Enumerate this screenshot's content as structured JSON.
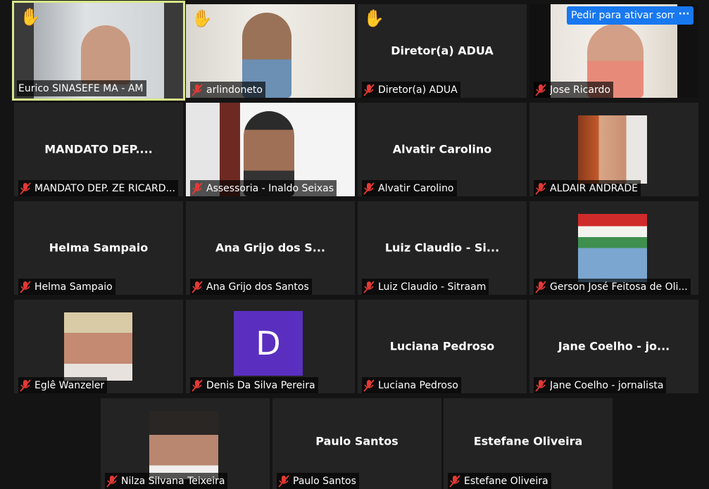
{
  "colors": {
    "background": "#141414",
    "tile": "#232323",
    "active_speaker_border": "#d8e88a",
    "muted_icon": "#e53935",
    "button_blue": "#1878f0",
    "avatar_purple": "#5a2fbf"
  },
  "controls": {
    "request_audio": "Pedir para ativar som",
    "more_options": "···"
  },
  "participants": [
    {
      "label": "Eurico SINASEFE MA - AM",
      "muted_icon": false,
      "hand_raised": true,
      "active_speaker": true
    },
    {
      "label": "arlindoneto",
      "muted_icon": "muted-mic-icon",
      "hand_raised": true
    },
    {
      "label": "Diretor(a) ADUA",
      "display": "Diretor(a) ADUA",
      "muted_icon": "muted-mic-icon",
      "hand_raised": true
    },
    {
      "label": "Jose Ricardo",
      "muted_icon": "muted-mic-icon"
    },
    {
      "label": "MANDATO DEP. ZÉ RICARD...",
      "display": "MANDATO DEP....",
      "muted_icon": "muted-mic-icon"
    },
    {
      "label": "Assessoria - Inaldo Seixas",
      "muted_icon": "muted-mic-icon"
    },
    {
      "label": "Alvatir Carolino",
      "display": "Alvatir Carolino",
      "muted_icon": "muted-mic-icon"
    },
    {
      "label": "ALDAIR ANDRADE",
      "muted_icon": "muted-mic-icon"
    },
    {
      "label": "Helma Sampaio",
      "display": "Helma Sampaio",
      "muted_icon": "muted-mic-icon"
    },
    {
      "label": "Ana Grijo dos Santos",
      "display": "Ana Grijo dos S...",
      "muted_icon": "muted-mic-icon"
    },
    {
      "label": "Luiz Claudio - Sitraam",
      "display": "Luiz Claudio - Si...",
      "muted_icon": "muted-mic-icon"
    },
    {
      "label": "Gerson José Feitosa de Oli...",
      "muted_icon": "muted-mic-icon"
    },
    {
      "label": "Eglê Wanzeler",
      "muted_icon": "muted-mic-icon"
    },
    {
      "label": "Denis Da Silva Pereira",
      "avatar_letter": "D",
      "muted_icon": "muted-mic-icon"
    },
    {
      "label": "Luciana Pedroso",
      "display": "Luciana Pedroso",
      "muted_icon": "muted-mic-icon"
    },
    {
      "label": "Jane Coelho - jornalista",
      "display": "Jane Coelho - jo...",
      "muted_icon": "muted-mic-icon"
    },
    {
      "label": "Nilza Silvana Teixeira",
      "muted_icon": "muted-mic-icon"
    },
    {
      "label": "Paulo Santos",
      "display": "Paulo Santos",
      "muted_icon": "muted-mic-icon"
    },
    {
      "label": "Estefane Oliveira",
      "display": "Estefane Oliveira",
      "muted_icon": "muted-mic-icon"
    }
  ]
}
